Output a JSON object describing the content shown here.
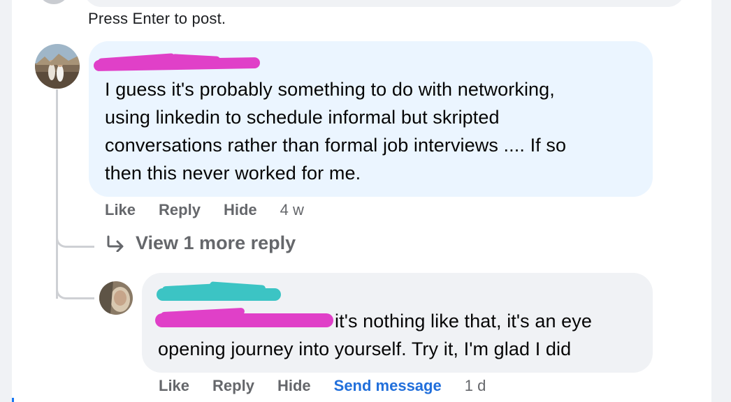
{
  "composer": {
    "hint": "Press Enter to post."
  },
  "comments": [
    {
      "author_redacted": true,
      "text": "I guess it's probably something to do with networking, using linkedin to schedule informal but skripted conversations rather than formal job interviews .... If so then this never worked for me.",
      "lines": [
        "I guess it's probably something to do with networking,",
        "using linkedin to schedule informal but skripted",
        "conversations rather than formal job interviews .... If so",
        "then this never worked for me."
      ],
      "actions": {
        "like": "Like",
        "reply": "Reply",
        "hide": "Hide",
        "time": "4 w"
      },
      "view_more": "View 1 more reply"
    },
    {
      "author_redacted": true,
      "text": "it's nothing like that, it's an eye opening journey into yourself. Try it, I'm glad I did",
      "lines": [
        "it's nothing like that, it's an eye",
        "opening journey into yourself. Try it, I'm glad I did"
      ],
      "actions": {
        "like": "Like",
        "reply": "Reply",
        "hide": "Hide",
        "send_message": "Send message",
        "time": "1 d"
      }
    }
  ],
  "colors": {
    "redaction_pink": "#e040c8",
    "redaction_teal": "#3cc4c4",
    "link_blue": "#216fdb"
  }
}
